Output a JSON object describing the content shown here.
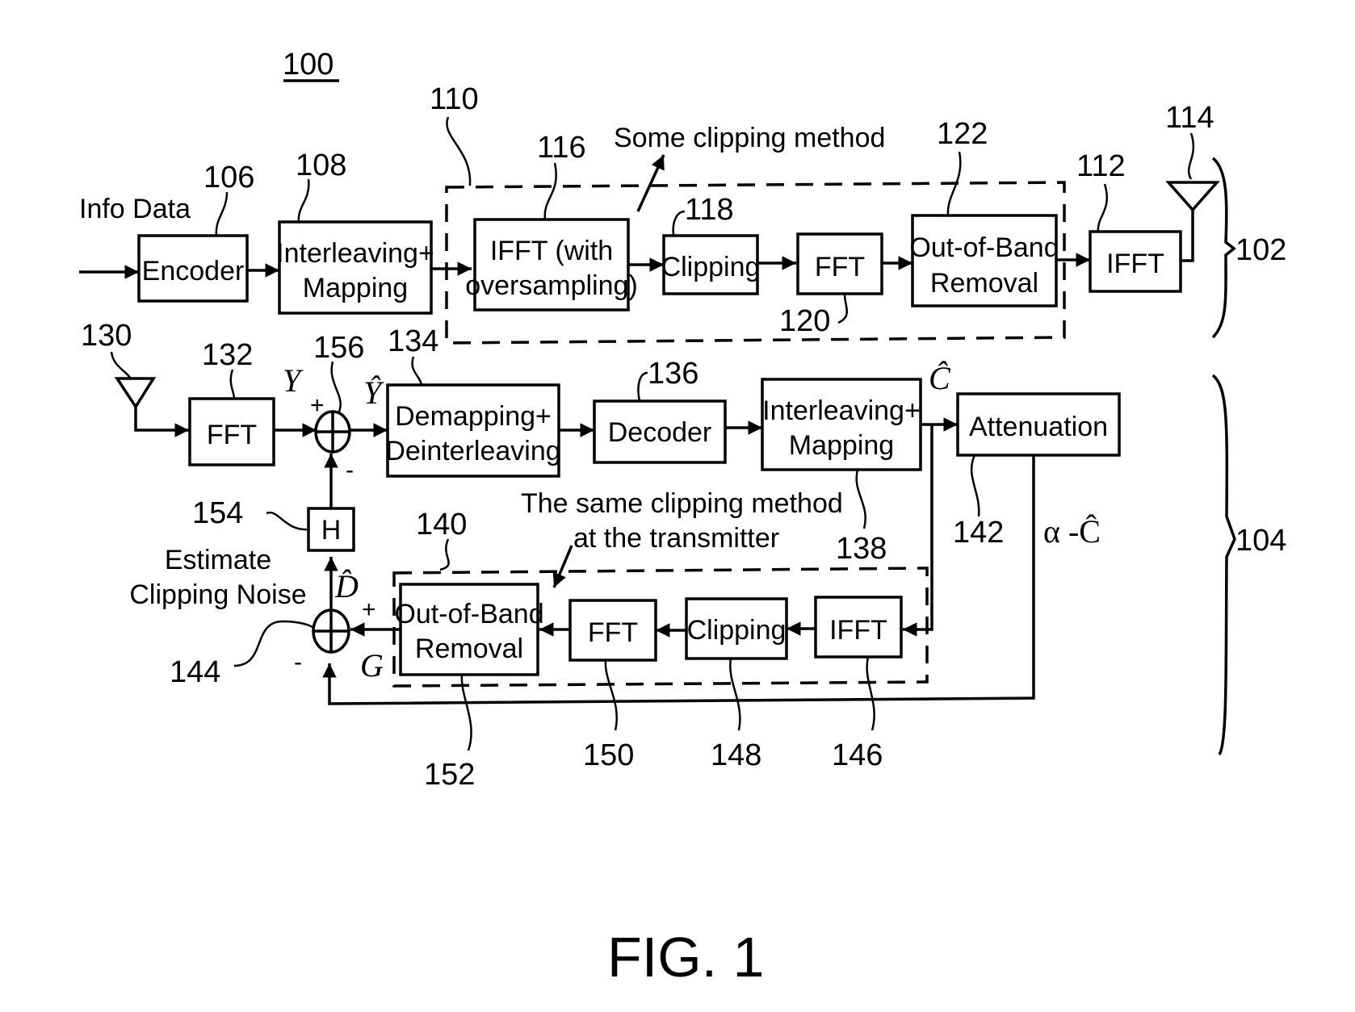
{
  "figure": {
    "ref": "100",
    "caption": "FIG. 1"
  },
  "transmitter": {
    "ref": "102",
    "input_label": "Info Data",
    "clipping_group_ref": "110",
    "clipping_note": "Some clipping method",
    "blocks": [
      {
        "id": "encoder",
        "ref": "106",
        "lines": [
          "Encoder"
        ]
      },
      {
        "id": "interleave-map",
        "ref": "108",
        "lines": [
          "Interleaving+",
          "Mapping"
        ]
      },
      {
        "id": "ifft-oversampling",
        "ref": "116",
        "lines": [
          "IFFT (with",
          "oversampling)"
        ]
      },
      {
        "id": "clipping",
        "ref": "118",
        "lines": [
          "Clipping"
        ]
      },
      {
        "id": "fft",
        "ref": "120",
        "lines": [
          "FFT"
        ]
      },
      {
        "id": "oob-removal",
        "ref": "122",
        "lines": [
          "Out-of-Band",
          "Removal"
        ]
      },
      {
        "id": "ifft",
        "ref": "112",
        "lines": [
          "IFFT"
        ]
      }
    ],
    "antenna_ref": "114"
  },
  "receiver": {
    "ref": "104",
    "antenna_ref": "130",
    "clipping_group_ref": "140",
    "clipping_note": [
      "The same clipping method",
      "at the transmitter"
    ],
    "estimate_note": [
      "Estimate",
      "Clipping Noise"
    ],
    "blocks": [
      {
        "id": "fft",
        "ref": "132",
        "lines": [
          "FFT"
        ]
      },
      {
        "id": "demap-deinterleave",
        "ref": "134",
        "lines": [
          "Demapping+",
          "Deinterleaving"
        ]
      },
      {
        "id": "decoder",
        "ref": "136",
        "lines": [
          "Decoder"
        ]
      },
      {
        "id": "interleave-map",
        "ref": "138",
        "lines": [
          "Interleaving+",
          "Mapping"
        ]
      },
      {
        "id": "attenuation",
        "ref": "142",
        "lines": [
          "Attenuation"
        ]
      },
      {
        "id": "ifft",
        "ref": "146",
        "lines": [
          "IFFT"
        ]
      },
      {
        "id": "clipping",
        "ref": "148",
        "lines": [
          "Clipping"
        ]
      },
      {
        "id": "fft2",
        "ref": "150",
        "lines": [
          "FFT"
        ]
      },
      {
        "id": "oob-removal",
        "ref": "152",
        "lines": [
          "Out-of-Band",
          "Removal"
        ]
      },
      {
        "id": "h",
        "ref": "154",
        "lines": [
          "H"
        ]
      }
    ],
    "summers": [
      {
        "id": "sum-main",
        "ref": "156",
        "plus": "+",
        "minus": "-"
      },
      {
        "id": "sum-noise",
        "ref": "144",
        "plus": "+",
        "minus": "-"
      }
    ],
    "signals": {
      "y": "Y",
      "y_hat": "Ŷ",
      "c_hat": "Ĉ",
      "alpha_c": "α -Ĉ",
      "d_hat": "D̂",
      "g": "G"
    }
  }
}
